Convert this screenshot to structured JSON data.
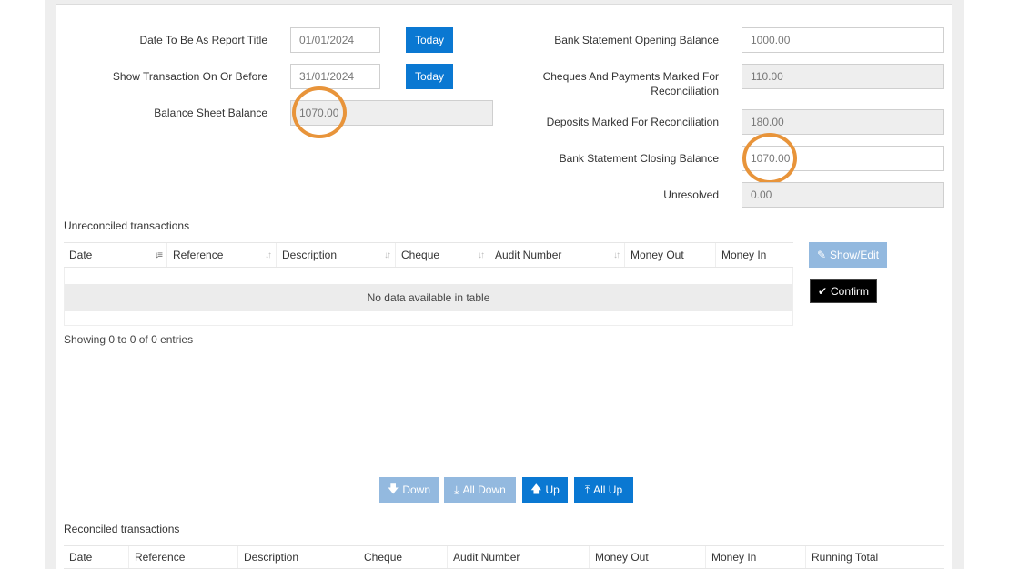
{
  "form": {
    "report_title_label": "Date To Be As Report Title",
    "report_title_value": "01/01/2024",
    "show_before_label": "Show Transaction On Or Before",
    "show_before_value": "31/01/2024",
    "today_label": "Today",
    "balance_sheet_label": "Balance Sheet Balance",
    "balance_sheet_value": "1070.00",
    "opening_balance_label": "Bank Statement Opening Balance",
    "opening_balance_value": "1000.00",
    "cheques_label_line1": "Cheques And Payments Marked For",
    "cheques_label_line2": "Reconciliation",
    "cheques_value": "110.00",
    "deposits_label": "Deposits Marked For Reconciliation",
    "deposits_value": "180.00",
    "closing_balance_label": "Bank Statement Closing Balance",
    "closing_balance_value": "1070.00",
    "unresolved_label": "Unresolved",
    "unresolved_value": "0.00"
  },
  "unreconciled": {
    "title": "Unreconciled transactions",
    "columns": [
      "Date",
      "Reference",
      "Description",
      "Cheque",
      "Audit Number",
      "Money Out",
      "Money In"
    ],
    "empty_text": "No data available in table",
    "info": "Showing 0 to 0 of 0 entries",
    "show_edit_label": "Show/Edit",
    "confirm_label": "Confirm"
  },
  "move_buttons": {
    "down": "Down",
    "all_down": "All Down",
    "up": "Up",
    "all_up": "All Up"
  },
  "reconciled": {
    "title": "Reconciled transactions",
    "columns": [
      "Date",
      "Reference",
      "Description",
      "Cheque",
      "Audit Number",
      "Money Out",
      "Money In",
      "Running Total"
    ]
  },
  "colors": {
    "primary_button": "#0a78d2",
    "disabled_button": "#93b9df",
    "confirm_button": "#000000",
    "highlight_circle": "#e8943a"
  }
}
